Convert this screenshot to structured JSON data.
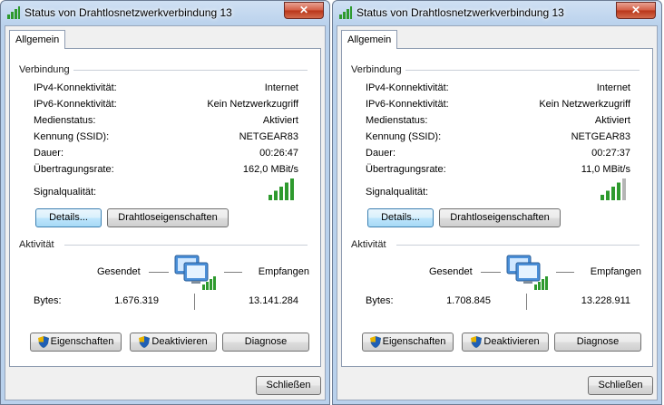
{
  "windows": [
    {
      "title": "Status von Drahtlosnetzwerkverbindung 13",
      "tab_label": "Allgemein",
      "connection": {
        "section_title": "Verbindung",
        "rows": [
          {
            "label": "IPv4-Konnektivität:",
            "value": "Internet"
          },
          {
            "label": "IPv6-Konnektivität:",
            "value": "Kein Netzwerkzugriff"
          },
          {
            "label": "Medienstatus:",
            "value": "Aktiviert"
          },
          {
            "label": "Kennung (SSID):",
            "value": "NETGEAR83"
          },
          {
            "label": "Dauer:",
            "value": "00:26:47"
          },
          {
            "label": "Übertragungsrate:",
            "value": "162,0 MBit/s"
          }
        ],
        "signal_label": "Signalqualität:",
        "signal_bars_filled": 5,
        "signal_bars_total": 5
      },
      "buttons": {
        "details": "Details...",
        "wireless_props": "Drahtloseigenschaften"
      },
      "activity": {
        "section_title": "Aktivität",
        "sent_label": "Gesendet",
        "received_label": "Empfangen",
        "bytes_label": "Bytes:",
        "bytes_sent": "1.676.319",
        "bytes_received": "13.141.284"
      },
      "actions": {
        "properties": "Eigenschaften",
        "disable": "Deaktivieren",
        "diagnose": "Diagnose"
      },
      "close_label": "Schließen"
    },
    {
      "title": "Status von Drahtlosnetzwerkverbindung 13",
      "tab_label": "Allgemein",
      "connection": {
        "section_title": "Verbindung",
        "rows": [
          {
            "label": "IPv4-Konnektivität:",
            "value": "Internet"
          },
          {
            "label": "IPv6-Konnektivität:",
            "value": "Kein Netzwerkzugriff"
          },
          {
            "label": "Medienstatus:",
            "value": "Aktiviert"
          },
          {
            "label": "Kennung (SSID):",
            "value": "NETGEAR83"
          },
          {
            "label": "Dauer:",
            "value": "00:27:37"
          },
          {
            "label": "Übertragungsrate:",
            "value": "11,0 MBit/s"
          }
        ],
        "signal_label": "Signalqualität:",
        "signal_bars_filled": 4,
        "signal_bars_total": 5
      },
      "buttons": {
        "details": "Details...",
        "wireless_props": "Drahtloseigenschaften"
      },
      "activity": {
        "section_title": "Aktivität",
        "sent_label": "Gesendet",
        "received_label": "Empfangen",
        "bytes_label": "Bytes:",
        "bytes_sent": "1.708.845",
        "bytes_received": "13.228.911"
      },
      "actions": {
        "properties": "Eigenschaften",
        "disable": "Deaktivieren",
        "diagnose": "Diagnose"
      },
      "close_label": "Schließen"
    }
  ],
  "icons": {
    "title": "wireless-network-icon",
    "close": "close-icon",
    "shield": "uac-shield-icon",
    "network": "network-computers-icon",
    "signal": "signal-strength-icon"
  },
  "colors": {
    "signal_green": "#2e9a2e",
    "signal_empty": "#b5b5b5",
    "close_red": "#c7472c"
  }
}
